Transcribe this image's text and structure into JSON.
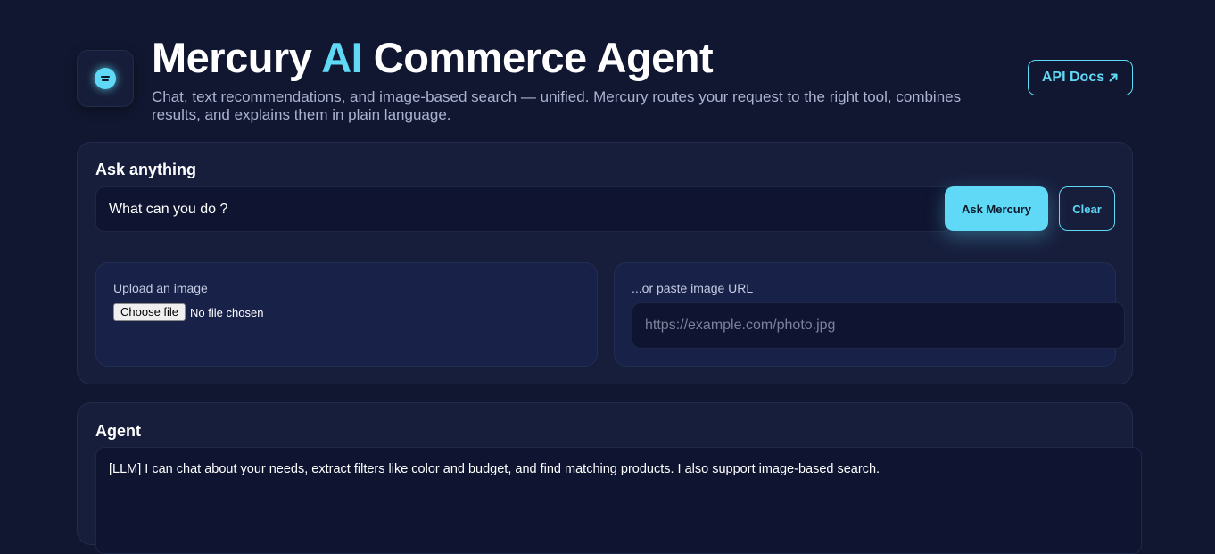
{
  "header": {
    "logo_icon": "logo-chat-icon",
    "title_prefix": "Mercury",
    "title_accent": "AI",
    "title_suffix": "Commerce Agent",
    "subtitle": "Chat, text recommendations, and image-based search — unified. Mercury routes your request to the right tool, combines results, and explains them in plain language.",
    "api_docs_label": "API Docs",
    "api_docs_icon": "arrow-up-right-icon"
  },
  "ask": {
    "title": "Ask anything",
    "query_value": "What can you do ?",
    "ask_button": "Ask Mercury",
    "clear_button": "Clear",
    "upload_label": "Upload an image",
    "choose_file_label": "Choose file",
    "file_status": "No file chosen",
    "url_label": "...or paste image URL",
    "url_placeholder": "https://example.com/photo.jpg"
  },
  "agent": {
    "title": "Agent",
    "response": "[LLM] I can chat about your needs, extract filters like color and budget, and find matching products. I also support image-based search."
  },
  "colors": {
    "background": "#111730",
    "card": "#171e3c",
    "accent": "#5fd9f5",
    "input": "#0f1430"
  }
}
